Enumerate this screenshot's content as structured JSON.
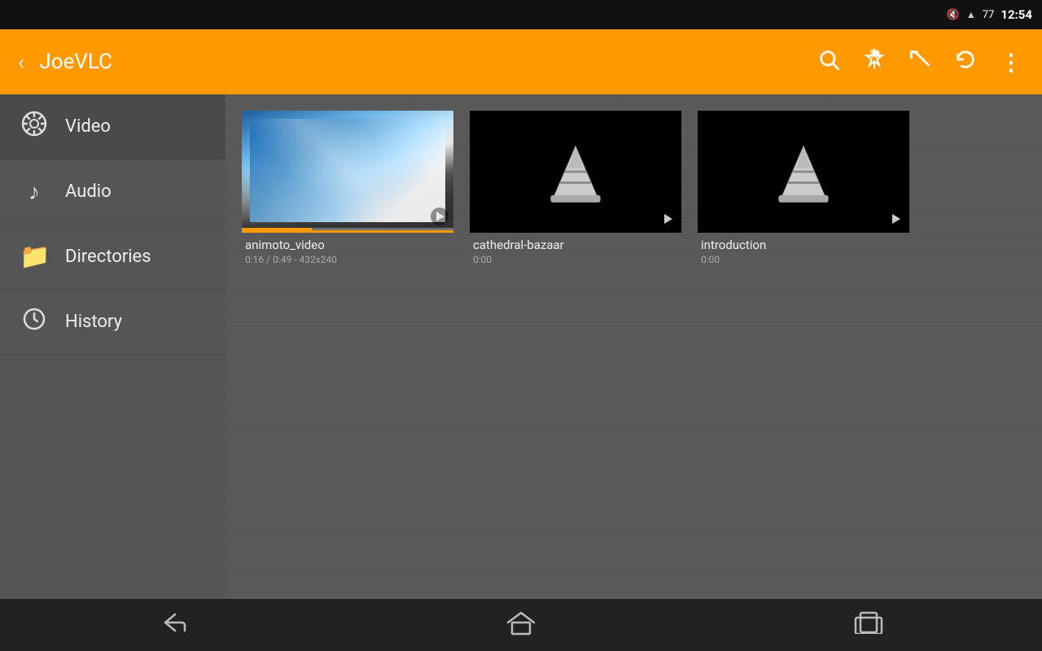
{
  "statusBar": {
    "time": "12:54",
    "battery": "77",
    "batterySymbol": "🔋"
  },
  "appBar": {
    "backLabel": "‹",
    "title": "JoeVLC",
    "searchLabel": "🔍",
    "pinLabel": "✦",
    "undoLabel": "↩",
    "refreshLabel": "↻",
    "moreLabel": "⋮"
  },
  "sidebar": {
    "items": [
      {
        "id": "video",
        "label": "Video",
        "icon": "🎬",
        "active": true
      },
      {
        "id": "audio",
        "label": "Audio",
        "icon": "♪",
        "active": false
      },
      {
        "id": "directories",
        "label": "Directories",
        "icon": "📁",
        "active": false
      },
      {
        "id": "history",
        "label": "History",
        "icon": "🕐",
        "active": false
      }
    ]
  },
  "content": {
    "videos": [
      {
        "id": "animoto",
        "title": "animoto_video",
        "meta": "0:16 / 0:49 - 432x240",
        "type": "snowboard",
        "active": true
      },
      {
        "id": "cathedral",
        "title": "cathedral-bazaar",
        "meta": "0:00",
        "type": "cone",
        "active": false
      },
      {
        "id": "introduction",
        "title": "introduction",
        "meta": "0:00",
        "type": "cone",
        "active": false
      }
    ]
  },
  "bottomBar": {
    "backLabel": "⬅",
    "homeLabel": "⌂",
    "recentLabel": "▭"
  }
}
